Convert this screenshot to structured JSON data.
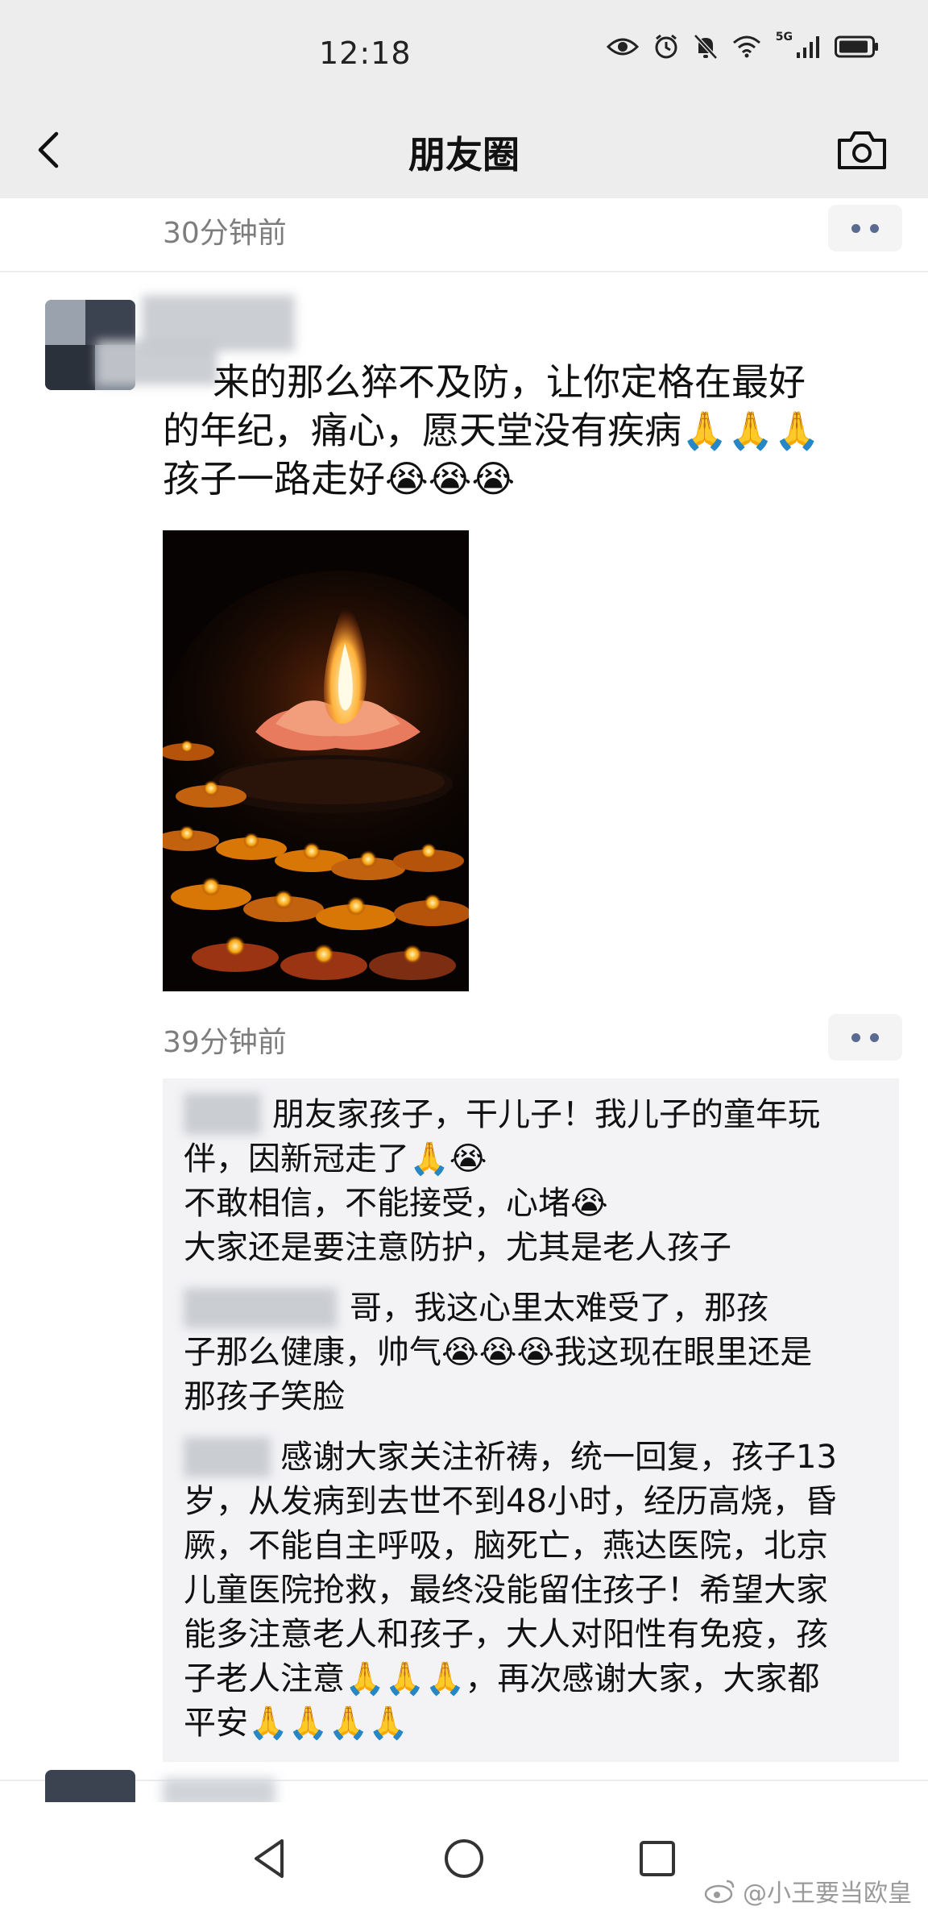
{
  "status_bar": {
    "time": "12:18",
    "network_label": "5G",
    "icons": [
      "eye-icon",
      "alarm-icon",
      "mute-icon",
      "wifi-icon",
      "signal-icon",
      "battery-icon"
    ]
  },
  "header": {
    "title": "朋友圈",
    "back_icon": "chevron-left-icon",
    "camera_icon": "camera-icon"
  },
  "feed": {
    "prev_post_time": "30分钟前",
    "post": {
      "text_lines": [
        "来的那么猝不及防，让你定格在最好",
        "的年纪，痛心，愿天堂没有疾病🙏🙏🙏",
        "孩子一路走好😭😭😭"
      ],
      "image": "candle-image",
      "time": "39分钟前",
      "comments": [
        {
          "lines": [
            "朋友家孩子，干儿子！我儿子的童年玩",
            "伴，因新冠走了🙏😭",
            "不敢相信，不能接受，心堵😭",
            "大家还是要注意防护，尤其是老人孩子"
          ]
        },
        {
          "lines": [
            "哥，我这心里太难受了，那孩",
            "子那么健康，帅气😭😭😭我这现在眼里还是",
            "那孩子笑脸"
          ]
        },
        {
          "lines": [
            "感谢大家关注祈祷，统一回复，孩子13",
            "岁，从发病到去世不到48小时，经历高烧，昏",
            "厥，不能自主呼吸，脑死亡，燕达医院，北京",
            "儿童医院抢救，最终没能留住孩子！希望大家",
            "能多注意老人和孩子，大人对阳性有免疫，孩",
            "子老人注意🙏🙏🙏，再次感谢大家，大家都",
            "平安🙏🙏🙏🙏"
          ]
        }
      ]
    }
  },
  "bottom_nav": {
    "icons": [
      "back-triangle-icon",
      "home-circle-icon",
      "recents-square-icon"
    ]
  },
  "watermark": {
    "text": "@小王要当欧皇",
    "icon": "weibo-icon"
  }
}
